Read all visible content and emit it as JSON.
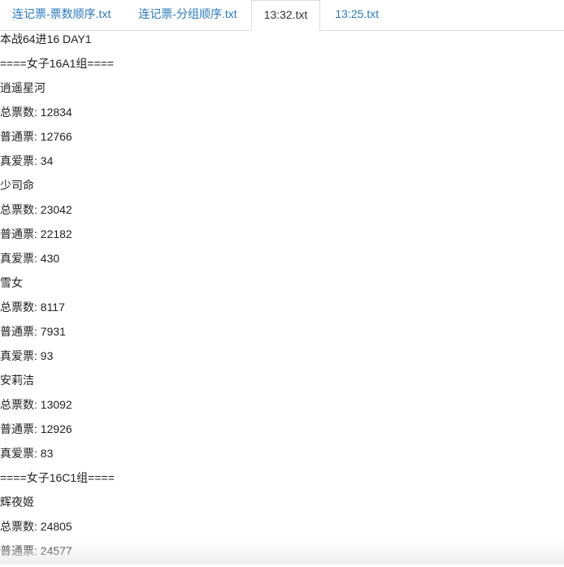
{
  "tabs": [
    {
      "label": "连记票-票数顺序.txt",
      "active": false
    },
    {
      "label": "连记票-分组顺序.txt",
      "active": false
    },
    {
      "label": "13:32.txt",
      "active": true
    },
    {
      "label": "13:25.txt",
      "active": false
    }
  ],
  "lines": [
    "本战64进16 DAY1",
    "====女子16A1组====",
    "逍遥星河",
    "总票数: 12834",
    "普通票: 12766",
    "真爱票: 34",
    "少司命",
    "总票数: 23042",
    "普通票: 22182",
    "真爱票: 430",
    "雪女",
    "总票数: 8117",
    "普通票: 7931",
    "真爱票: 93",
    "安莉洁",
    "总票数: 13092",
    "普通票: 12926",
    "真爱票: 83",
    "====女子16C1组====",
    "辉夜姬",
    "总票数: 24805",
    "普通票: 24577"
  ]
}
